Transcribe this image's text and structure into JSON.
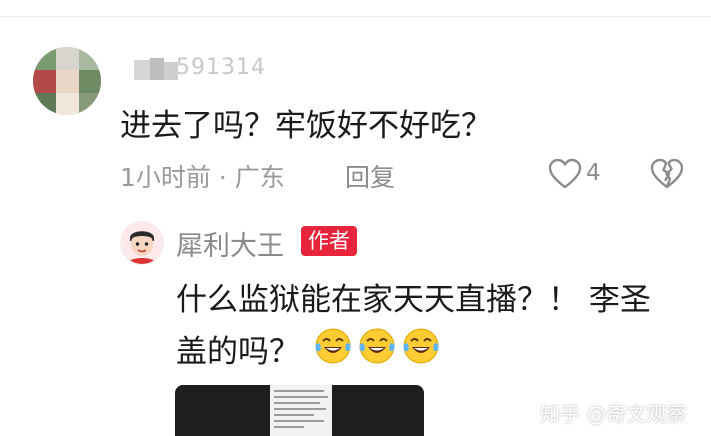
{
  "comment": {
    "username_visible": "591314",
    "text": "进去了吗？牢饭好不好吃？",
    "meta": "1小时前 · 广东",
    "reply_label": "回复",
    "like_count": "4"
  },
  "reply": {
    "username": "犀利大王",
    "badge": "作者",
    "line1": "什么监狱能在家天天直播？！ 李圣",
    "line2": "盖的吗？"
  },
  "icons": {
    "like": "heart-outline-icon",
    "dislike": "broken-heart-icon",
    "emoji": "tears-of-joy-emoji"
  },
  "watermark": "知乎 @奇文观察",
  "colors": {
    "badge": "#e8243c",
    "meta": "#9a9a9a",
    "text": "#1a1a1a"
  }
}
